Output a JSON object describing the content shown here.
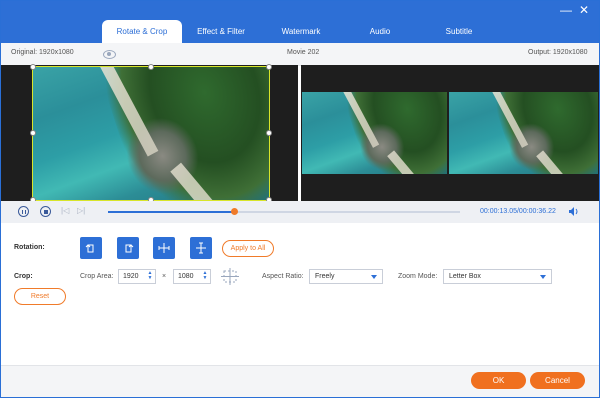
{
  "window": {
    "tabs": [
      {
        "label": "Rotate & Crop",
        "active": true
      },
      {
        "label": "Effect & Filter"
      },
      {
        "label": "Watermark"
      },
      {
        "label": "Audio"
      },
      {
        "label": "Subtitle"
      }
    ],
    "minimize_glyph": "—",
    "close_glyph": "✕"
  },
  "preview": {
    "original_label": "Original: 1920x1080",
    "title": "Movie 202",
    "output_label": "Output: 1920x1080"
  },
  "playback": {
    "time": "00:00:13.05/00:00:36.22",
    "progress_fraction": 0.36
  },
  "rotation": {
    "label": "Rotation:",
    "apply_all": "Apply to All"
  },
  "crop": {
    "label": "Crop:",
    "area_label": "Crop Area:",
    "width": "1920",
    "times": "×",
    "height": "1080",
    "aspect_label": "Aspect Ratio:",
    "aspect_value": "Freely",
    "zoom_label": "Zoom Mode:",
    "zoom_value": "Letter Box",
    "reset": "Reset"
  },
  "footer": {
    "ok": "OK",
    "cancel": "Cancel"
  },
  "colors": {
    "accent": "#2d6fd6",
    "orange": "#f0701f"
  }
}
